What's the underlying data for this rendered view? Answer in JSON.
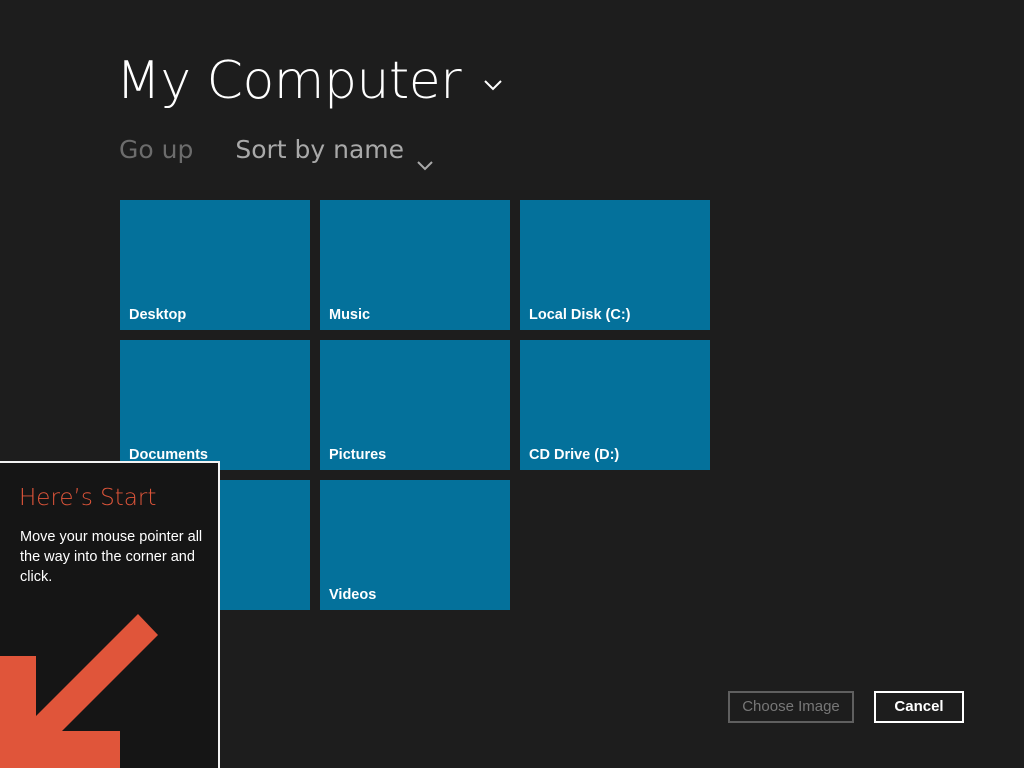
{
  "colors": {
    "background": "#1d1d1d",
    "tile": "#04719b",
    "tip_title": "#e0553a",
    "tip_arrow": "#e0553a",
    "muted_text": "#6c6c6c"
  },
  "header": {
    "title": "My Computer",
    "title_icon": "chevron-down-icon"
  },
  "toolbar": {
    "go_up_label": "Go up",
    "sort_label": "Sort by name",
    "sort_icon": "chevron-down-icon"
  },
  "tiles": [
    {
      "label": "Desktop"
    },
    {
      "label": "Music"
    },
    {
      "label": "Local Disk (C:)"
    },
    {
      "label": "Documents"
    },
    {
      "label": "Pictures"
    },
    {
      "label": "CD Drive (D:)"
    },
    {
      "label": ""
    },
    {
      "label": "Videos"
    }
  ],
  "start_tip": {
    "title": "Here’s Start",
    "body": "Move your mouse pointer all the way into the corner and click.",
    "arrow_icon": "arrow-down-left-icon"
  },
  "footer": {
    "choose_label": "Choose Image",
    "cancel_label": "Cancel"
  }
}
